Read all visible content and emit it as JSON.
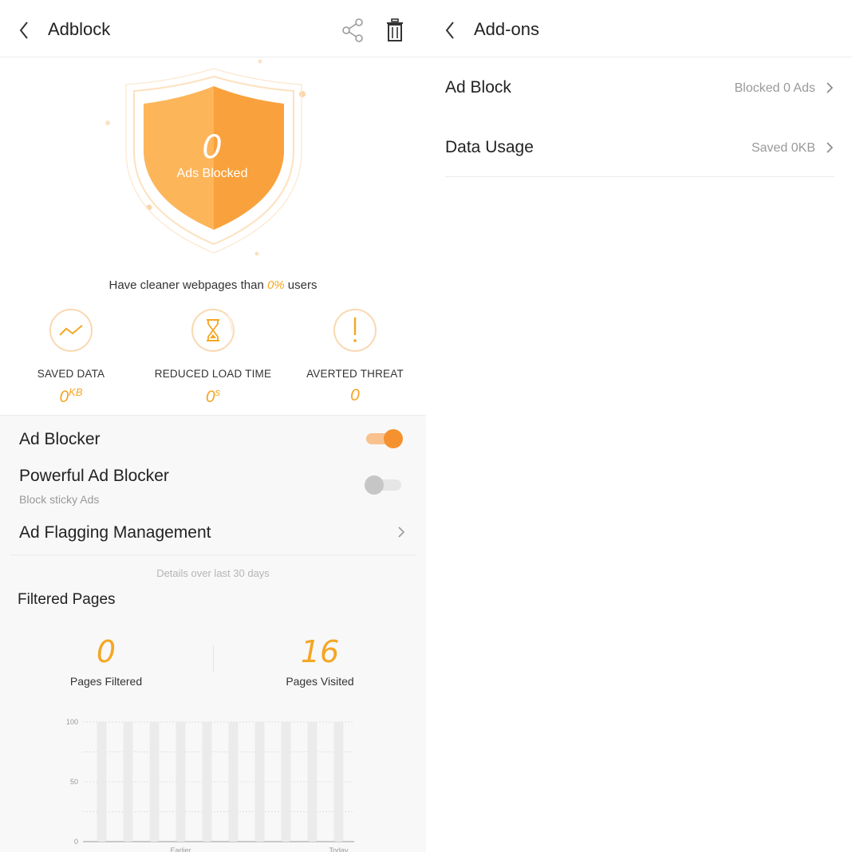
{
  "adblock": {
    "title": "Adblock",
    "shield": {
      "count": "0",
      "label": "Ads Blocked"
    },
    "cleaner": {
      "prefix": "Have cleaner webpages than ",
      "percent": "0%",
      "suffix": " users"
    },
    "stats": [
      {
        "label": "SAVED DATA",
        "value": "0",
        "unit": "KB",
        "icon": "trend-line-icon"
      },
      {
        "label": "REDUCED LOAD TIME",
        "value": "0",
        "unit": "s",
        "icon": "hourglass-icon"
      },
      {
        "label": "AVERTED THREAT",
        "value": "0",
        "unit": "",
        "icon": "exclamation-icon"
      }
    ],
    "settings": {
      "ad_blocker": {
        "label": "Ad Blocker",
        "enabled": true
      },
      "powerful_ad_blocker": {
        "label": "Powerful Ad Blocker",
        "sub": "Block sticky Ads",
        "enabled": false
      },
      "ad_flagging": {
        "label": "Ad Flagging Management"
      }
    },
    "details_note": "Details over last 30 days",
    "filtered": {
      "title": "Filtered Pages",
      "pages_filtered": {
        "value": "0",
        "label": "Pages Filtered"
      },
      "pages_visited": {
        "value": "16",
        "label": "Pages Visited"
      }
    },
    "colors": {
      "accent": "#f5a623",
      "shield_light": "#fdb55a",
      "shield_dark": "#f9a13c",
      "toggle_on": "#f5922f"
    }
  },
  "chart_data": {
    "type": "bar",
    "categories": [
      "",
      "",
      "",
      "Earlier",
      "",
      "",
      "",
      "",
      "",
      "Today"
    ],
    "series": [
      {
        "values": [
          100,
          100,
          100,
          100,
          100,
          100,
          100,
          100,
          100,
          100
        ]
      },
      {
        "values": [
          0,
          0,
          0,
          0,
          0,
          0,
          0,
          0,
          0,
          0
        ]
      }
    ],
    "yticks": [
      "100",
      "50",
      "0"
    ],
    "ylim": [
      0,
      100
    ],
    "grid": true
  },
  "addons": {
    "title": "Add-ons",
    "rows": [
      {
        "name": "Ad Block",
        "value": "Blocked 0 Ads"
      },
      {
        "name": "Data Usage",
        "value": "Saved 0KB"
      }
    ]
  }
}
